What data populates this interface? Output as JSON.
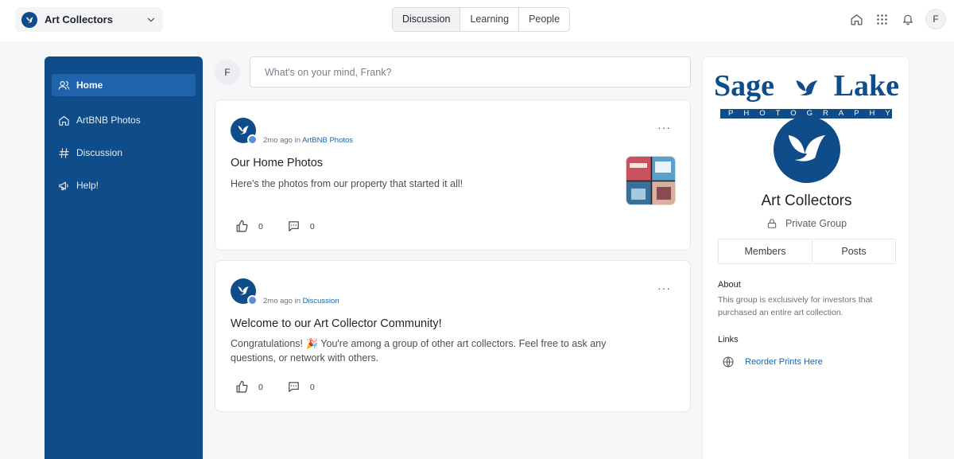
{
  "header": {
    "group_name": "Art Collectors",
    "tabs": [
      {
        "label": "Discussion",
        "active": true
      },
      {
        "label": "Learning",
        "active": false
      },
      {
        "label": "People",
        "active": false
      }
    ],
    "user_initial": "F",
    "icons": [
      "home-icon",
      "apps-grid-icon",
      "bell-icon"
    ]
  },
  "sidebar": {
    "items": [
      {
        "label": "Home",
        "icon": "user-group-icon",
        "active": true
      },
      {
        "label": "ArtBNB Photos",
        "icon": "house-icon",
        "active": false
      },
      {
        "label": "Discussion",
        "icon": "hashtag-icon",
        "active": false
      },
      {
        "label": "Help!",
        "icon": "megaphone-icon",
        "active": false
      }
    ]
  },
  "composer": {
    "avatar_initial": "F",
    "placeholder": "What's on your mind, Frank?"
  },
  "posts": [
    {
      "time": "2mo ago",
      "in_word": "in",
      "channel": "ArtBNB Photos",
      "title": "Our Home Photos",
      "body": "Here's the photos from our property that started it all!",
      "likes": "0",
      "comments": "0",
      "has_thumbnail": true
    },
    {
      "time": "2mo ago",
      "in_word": "in",
      "channel": "Discussion",
      "title": "Welcome to our Art Collector Community!",
      "body": "Congratulations! 🎉 You're among a group of other art collectors. Feel free to ask any questions, or network with others.",
      "likes": "0",
      "comments": "0",
      "has_thumbnail": false
    }
  ],
  "group_panel": {
    "brand_word_1": "Sage",
    "brand_word_2": "Lake",
    "brand_tagline": "PHOTOGRAPHY",
    "name": "Art Collectors",
    "privacy": "Private Group",
    "members_label": "Members",
    "posts_label": "Posts",
    "about_heading": "About",
    "about_text": "This group is exclusively for investors that purchased an entire art collection.",
    "links_heading": "Links",
    "links": [
      {
        "label": "Reorder Prints Here",
        "icon": "globe-icon"
      }
    ]
  },
  "colors": {
    "brand_blue": "#0f4c8a",
    "sidebar_active": "#1f63ad",
    "link_blue": "#1f63ad"
  }
}
